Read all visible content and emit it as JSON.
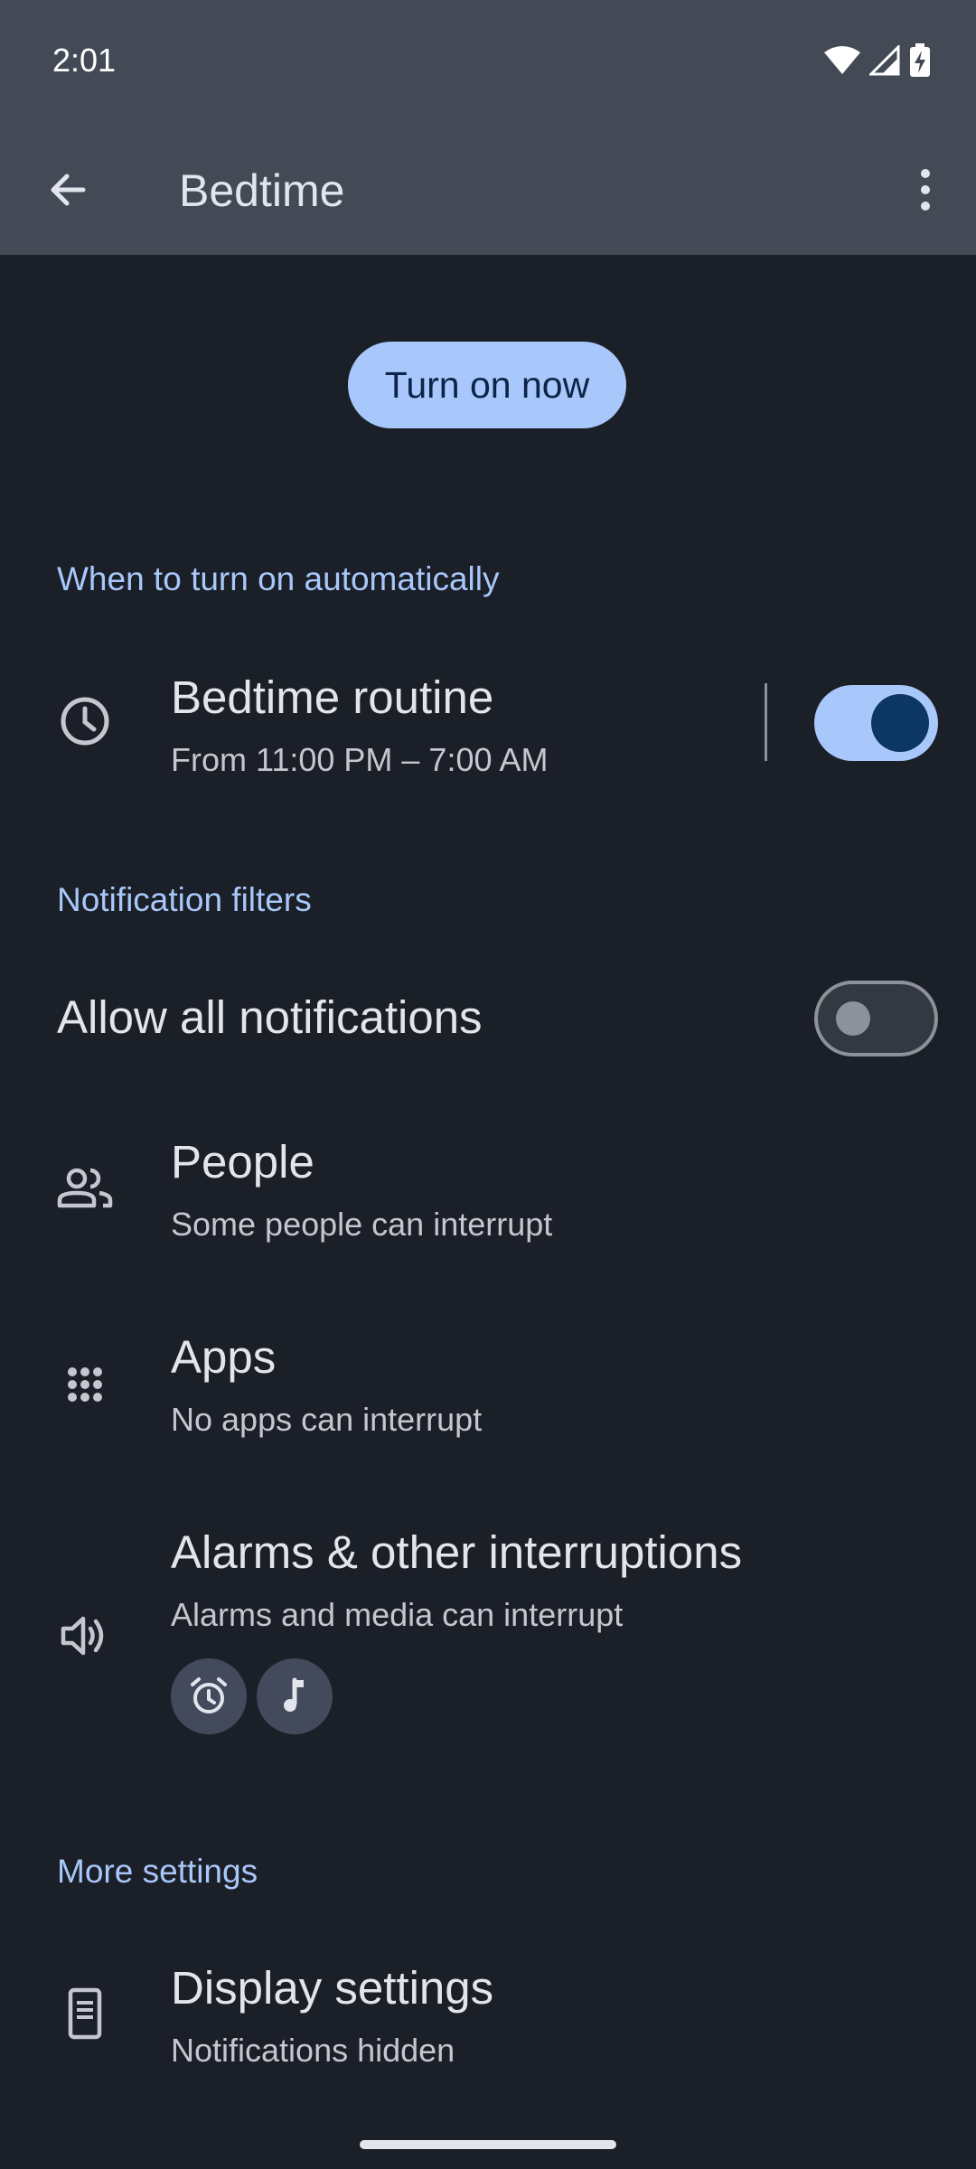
{
  "status": {
    "time": "2:01"
  },
  "appbar": {
    "title": "Bedtime"
  },
  "primary_button": {
    "label": "Turn on now"
  },
  "sections": {
    "auto": "When to turn on automatically",
    "filters": "Notification filters",
    "more": "More settings"
  },
  "routine": {
    "title": "Bedtime routine",
    "subtitle": "From 11:00 PM – 7:00 AM",
    "enabled": true
  },
  "allow_all": {
    "title": "Allow all notifications",
    "enabled": false
  },
  "people": {
    "title": "People",
    "subtitle": "Some people can interrupt"
  },
  "apps": {
    "title": "Apps",
    "subtitle": "No apps can interrupt"
  },
  "alarms": {
    "title": "Alarms & other interruptions",
    "subtitle": "Alarms and media can interrupt",
    "chips": [
      "alarm-icon",
      "music-note-icon"
    ]
  },
  "display": {
    "title": "Display settings",
    "subtitle": "Notifications hidden"
  },
  "colors": {
    "accent": "#a8c7fa",
    "background": "#1b1f27",
    "appbar": "#434a56"
  }
}
